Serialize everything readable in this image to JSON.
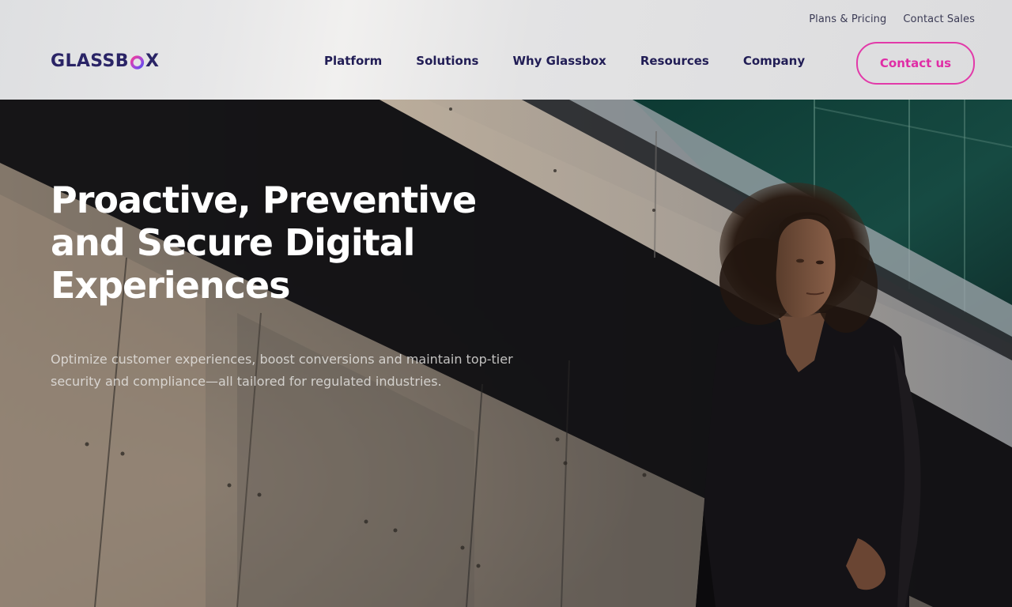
{
  "header": {
    "logo": {
      "before": "GLASSB",
      "after": "X"
    },
    "utility_links": [
      {
        "label": "Plans & Pricing"
      },
      {
        "label": "Contact Sales"
      }
    ],
    "nav": [
      {
        "label": "Platform"
      },
      {
        "label": "Solutions"
      },
      {
        "label": "Why Glassbox"
      },
      {
        "label": "Resources"
      },
      {
        "label": "Company"
      }
    ],
    "cta_label": "Contact us"
  },
  "hero": {
    "title_lines": [
      "Proactive, Preventive",
      "and Secure Digital",
      "Experiences"
    ],
    "subtitle": "Optimize customer experiences, boost conversions and maintain top-tier security and compliance—all tailored for regulated industries."
  },
  "colors": {
    "brand_navy": "#211d55",
    "brand_pink": "#e02da6",
    "brand_purple": "#7b3fe4"
  }
}
